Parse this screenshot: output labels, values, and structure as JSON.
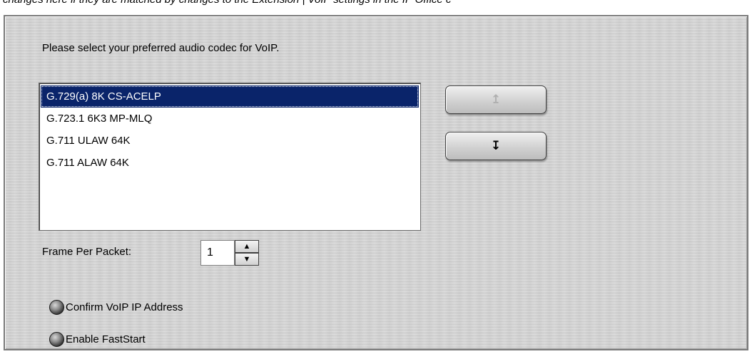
{
  "top_note": "changes here if they are matched by changes to the Extension | VoIP settings in the IP Office c",
  "prompt": "Please select your preferred audio codec for VoIP.",
  "codecs": [
    {
      "label": "G.729(a) 8K CS-ACELP",
      "selected": true
    },
    {
      "label": "G.723.1 6K3 MP-MLQ",
      "selected": false
    },
    {
      "label": "G.711 ULAW 64K",
      "selected": false
    },
    {
      "label": "G.711 ALAW 64K",
      "selected": false
    }
  ],
  "buttons": {
    "move_up_glyph": "↥",
    "move_down_glyph": "↧",
    "move_up_enabled": false,
    "move_down_enabled": true
  },
  "frame_per_packet": {
    "label": "Frame Per Packet:",
    "value": "1",
    "spin_up_glyph": "▲",
    "spin_down_glyph": "▼"
  },
  "options": {
    "confirm_voip_ip": "Confirm VoIP IP Address",
    "enable_faststart": "Enable FastStart"
  },
  "colors": {
    "selection": "#0a246a",
    "panel": "#d4d4d4"
  }
}
